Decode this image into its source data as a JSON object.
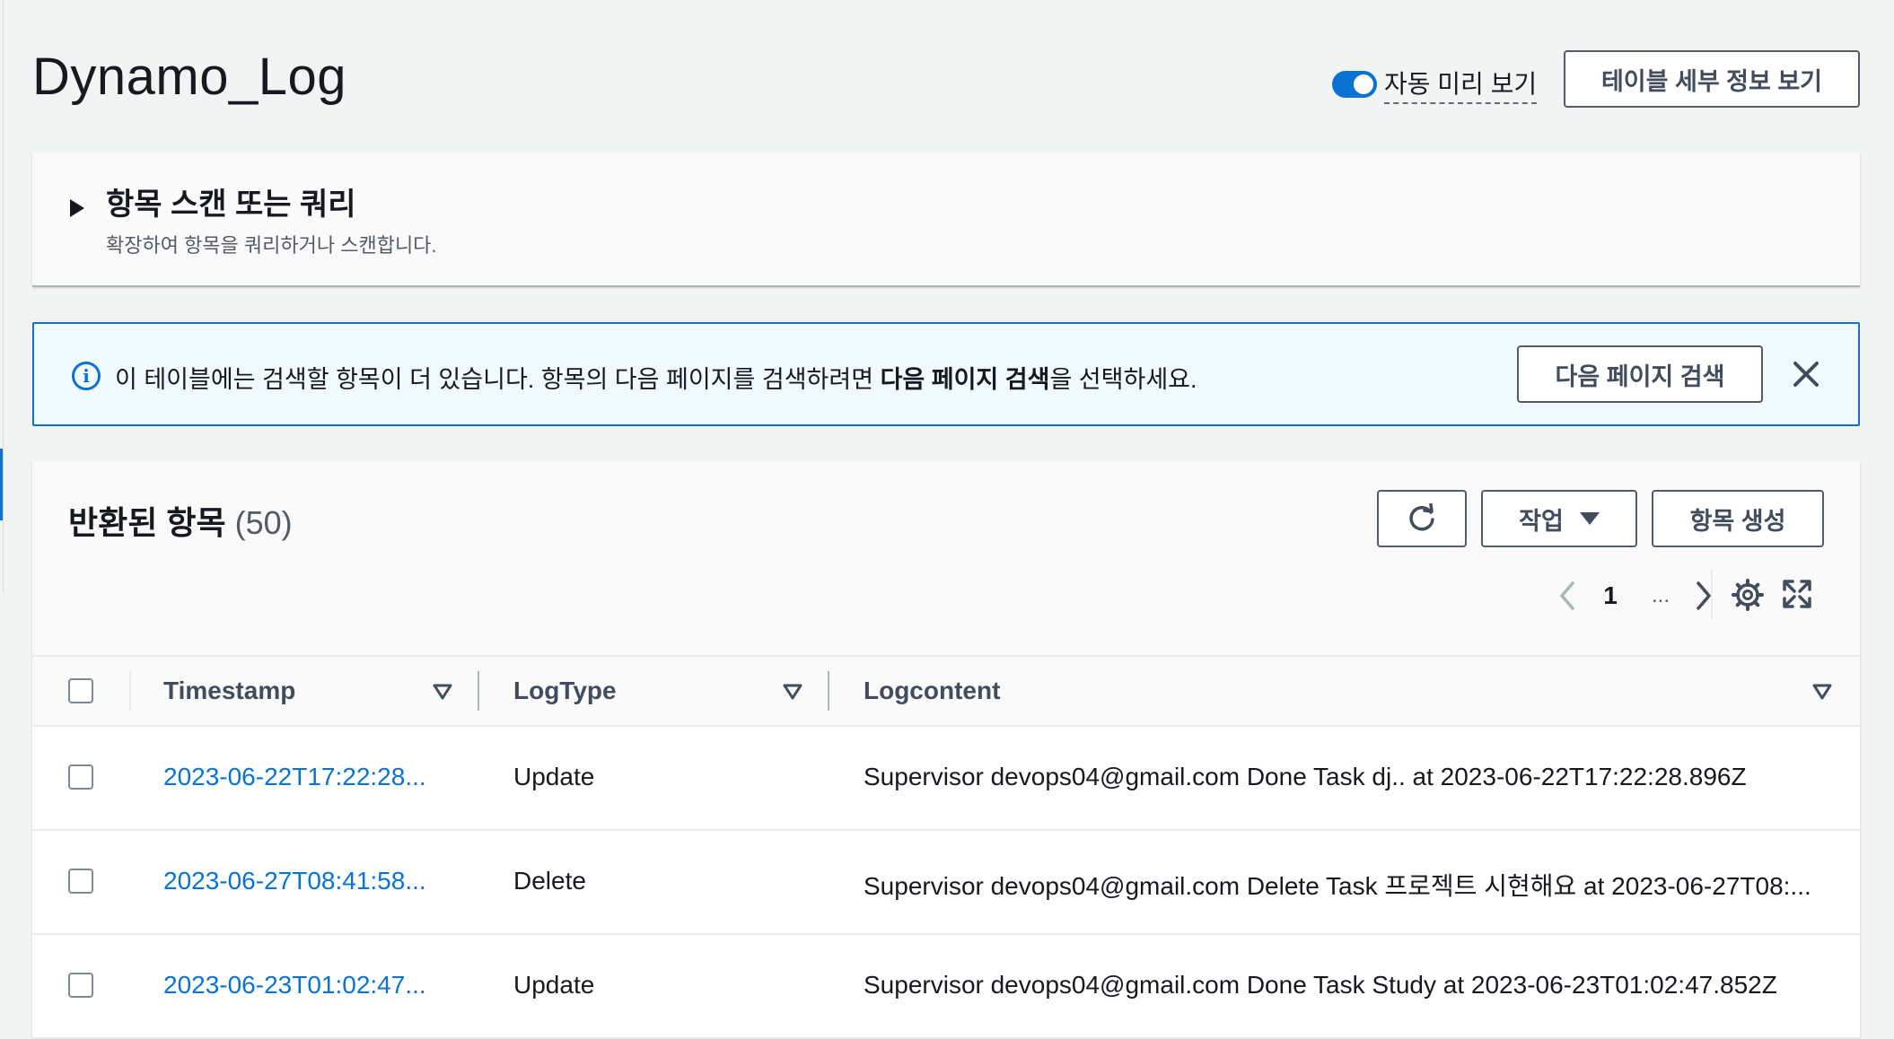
{
  "header": {
    "title": "Dynamo_Log",
    "auto_preview_label": "자동 미리 보기",
    "table_details_label": "테이블 세부 정보 보기"
  },
  "scan_panel": {
    "title": "항목 스캔 또는 쿼리",
    "description": "확장하여 항목을 쿼리하거나 스캔합니다."
  },
  "info_banner": {
    "text_before": "이 테이블에는 검색할 항목이 더 있습니다. 항목의 다음 페이지를 검색하려면 ",
    "text_bold": "다음 페이지 검색",
    "text_after": "을 선택하세요.",
    "button_label": "다음 페이지 검색"
  },
  "items": {
    "title": "반환된 항목",
    "count": "(50)",
    "actions_label": "작업",
    "create_label": "항목 생성",
    "pagination": {
      "current_page": "1",
      "ellipsis": "..."
    },
    "columns": [
      "Timestamp",
      "LogType",
      "Logcontent"
    ],
    "rows": [
      {
        "timestamp": "2023-06-22T17:22:28...",
        "logtype": "Update",
        "logcontent": "Supervisor devops04@gmail.com Done Task dj..  at 2023-06-22T17:22:28.896Z"
      },
      {
        "timestamp": "2023-06-27T08:41:58...",
        "logtype": "Delete",
        "logcontent": "Supervisor devops04@gmail.com Delete Task 프로젝트 시현해요 at 2023-06-27T08:..."
      },
      {
        "timestamp": "2023-06-23T01:02:47...",
        "logtype": "Update",
        "logcontent": "Supervisor devops04@gmail.com Done Task Study at 2023-06-23T01:02:47.852Z"
      }
    ]
  },
  "colors": {
    "accent": "#0972d3",
    "background": "#f2f3f3",
    "text": "#16191f",
    "link": "#0972d3"
  }
}
